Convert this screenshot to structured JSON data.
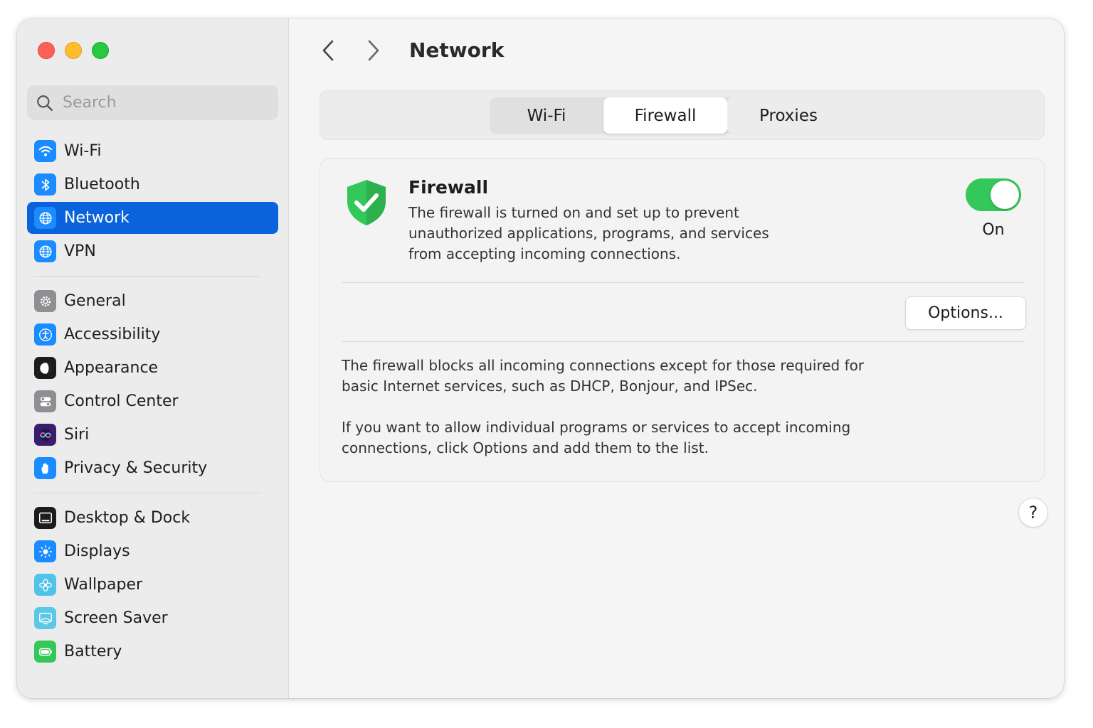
{
  "sidebar": {
    "search": {
      "placeholder": "Search"
    },
    "groups": [
      [
        {
          "label": "Wi-Fi",
          "icon": "wifi-icon",
          "color": "#1a8cff",
          "active": false
        },
        {
          "label": "Bluetooth",
          "icon": "bluetooth-icon",
          "color": "#1a8cff",
          "active": false
        },
        {
          "label": "Network",
          "icon": "globe-icon",
          "color": "#1a8cff",
          "active": true
        },
        {
          "label": "VPN",
          "icon": "globe-icon",
          "color": "#1a8cff",
          "active": false
        }
      ],
      [
        {
          "label": "General",
          "icon": "gear-icon",
          "color": "#8e8e93",
          "active": false
        },
        {
          "label": "Accessibility",
          "icon": "accessibility-icon",
          "color": "#1a8cff",
          "active": false
        },
        {
          "label": "Appearance",
          "icon": "appearance-icon",
          "color": "#1c1c1e",
          "active": false
        },
        {
          "label": "Control Center",
          "icon": "control-center-icon",
          "color": "#8e8e93",
          "active": false
        },
        {
          "label": "Siri",
          "icon": "siri-icon",
          "color": "#3a1d6e",
          "active": false
        },
        {
          "label": "Privacy & Security",
          "icon": "hand-icon",
          "color": "#1a8cff",
          "active": false
        }
      ],
      [
        {
          "label": "Desktop & Dock",
          "icon": "dock-icon",
          "color": "#1c1c1e",
          "active": false
        },
        {
          "label": "Displays",
          "icon": "sun-icon",
          "color": "#1a8cff",
          "active": false
        },
        {
          "label": "Wallpaper",
          "icon": "flower-icon",
          "color": "#4fc3e8",
          "active": false
        },
        {
          "label": "Screen Saver",
          "icon": "screen-saver-icon",
          "color": "#5ac8e6",
          "active": false
        },
        {
          "label": "Battery",
          "icon": "battery-icon",
          "color": "#34c759",
          "active": false
        }
      ]
    ]
  },
  "main": {
    "title": "Network",
    "tabs": [
      "Wi-Fi",
      "Firewall",
      "Proxies"
    ],
    "selected_tab": "Firewall",
    "firewall": {
      "title": "Firewall",
      "description": "The firewall is turned on and set up to prevent unauthorized applications, programs, and services from accepting incoming connections.",
      "toggle_label": "On",
      "toggle_on": true,
      "options_label": "Options...",
      "info1": "The firewall blocks all incoming connections except for those required for basic Internet services, such as DHCP, Bonjour, and IPSec.",
      "info2": "If you want to allow individual programs or services to accept incoming connections, click Options and add them to the list."
    },
    "help_label": "?"
  },
  "colors": {
    "accent": "#0a63dc",
    "toggle_on": "#34c759",
    "shield": "#34c759"
  }
}
